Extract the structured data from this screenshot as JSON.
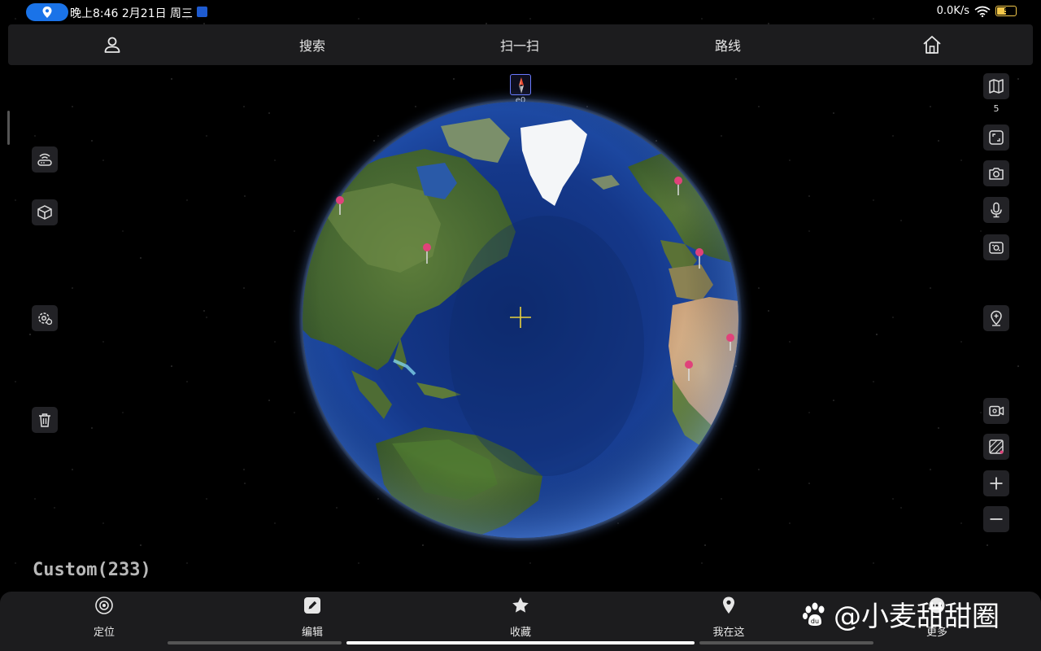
{
  "status_bar": {
    "time": "晚上8:46 2月21日 周三",
    "network_speed": "0.0K/s",
    "battery_level": "5"
  },
  "top_bar": {
    "items": [
      {
        "id": "profile",
        "label": "",
        "icon": "user-icon"
      },
      {
        "id": "search",
        "label": "搜索"
      },
      {
        "id": "scan",
        "label": "扫一扫"
      },
      {
        "id": "route",
        "label": "路线"
      },
      {
        "id": "home",
        "label": "",
        "icon": "home-icon"
      }
    ]
  },
  "compass": {
    "label": "e0"
  },
  "right_toolbar": {
    "layer_count": "5",
    "icons": [
      "map-layers-icon",
      "fullscreen-icon",
      "camera-icon",
      "microphone-icon",
      "rotate-camera-icon",
      "add-pin-icon",
      "record-video-icon",
      "ruler-icon",
      "zoom-in-icon",
      "zoom-out-icon"
    ]
  },
  "left_toolbar": {
    "icons": [
      "router-icon",
      "3d-box-icon",
      "settings-icon",
      "trash-icon"
    ]
  },
  "map_label": "Custom(233)",
  "bottom_bar": {
    "items": [
      {
        "label": "定位",
        "icon": "locate-icon"
      },
      {
        "label": "编辑",
        "icon": "edit-icon"
      },
      {
        "label": "收藏",
        "icon": "favorite-icon"
      },
      {
        "label": "我在这",
        "icon": "location-pin-icon"
      },
      {
        "label": "更多",
        "icon": "more-icon"
      }
    ]
  },
  "watermark": {
    "text": "@小麦甜甜圈"
  },
  "colors": {
    "accent": "#1a73e8",
    "panel": "#1c1c1e",
    "pin": "#e0427a"
  }
}
